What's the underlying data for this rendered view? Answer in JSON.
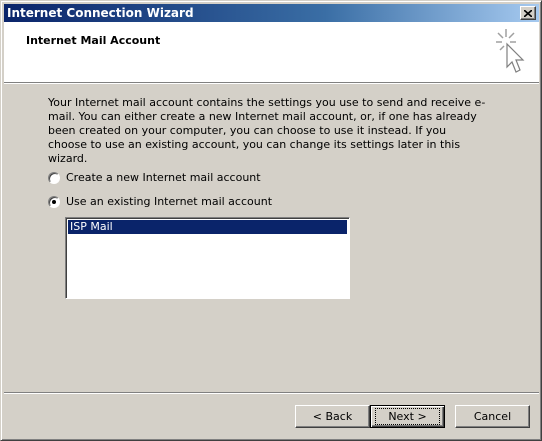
{
  "window": {
    "title": "Internet Connection Wizard"
  },
  "header": {
    "title": "Internet Mail Account",
    "icon": "wizard-sparkle-cursor-icon"
  },
  "description": "Your Internet mail account contains the settings you use to send and receive e-mail. You can either create a new Internet mail account, or, if one has already been created on your computer, you can choose to use it instead. If you choose to use an existing account, you can change its settings later in this wizard.",
  "options": [
    {
      "label": "Create a new Internet mail account",
      "checked": false
    },
    {
      "label": "Use an existing Internet mail account",
      "checked": true
    }
  ],
  "accounts": [
    {
      "name": "ISP Mail",
      "selected": true
    }
  ],
  "buttons": {
    "back": "< Back",
    "next": "Next >",
    "cancel": "Cancel"
  },
  "colors": {
    "title_bar": "#0a246a",
    "selection": "#0a246a",
    "face": "#d4d0c8"
  }
}
